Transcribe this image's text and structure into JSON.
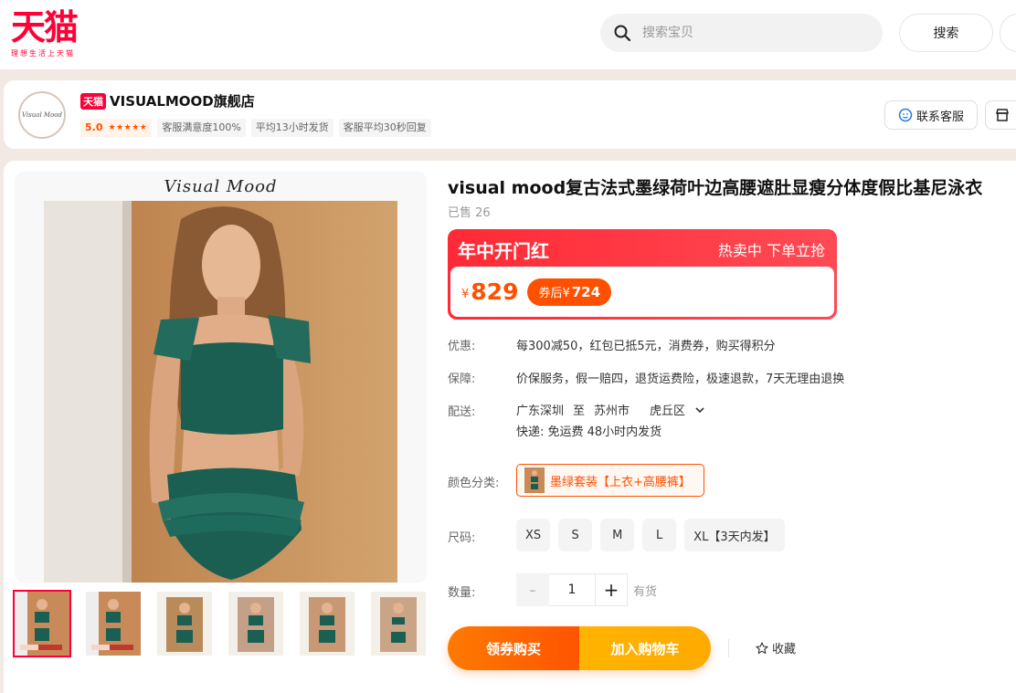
{
  "header": {
    "logo_text": "天猫",
    "logo_slogan": "理想生活上天猫",
    "search_placeholder": "搜索宝贝",
    "search_button": "搜索"
  },
  "shop": {
    "tmall_badge": "天猫",
    "name": "VISUALMOOD旗舰店",
    "avatar_text": "Visual Mood",
    "rating": "5.0",
    "stars": "★★★★★",
    "tags": [
      "客服满意度100%",
      "平均13小时发货",
      "客服平均30秒回复"
    ],
    "cs_button": "联系客服"
  },
  "gallery": {
    "brand_script": "Visual Mood"
  },
  "product": {
    "title": "visual mood复古法式墨绿荷叶边高腰遮肚显瘦分体度假比基尼泳衣",
    "sold": "已售 26",
    "promo_title": "年中开门红",
    "promo_sub": "热卖中 下单立抢",
    "currency": "¥",
    "price": "829",
    "coupon_prefix": "券后¥",
    "coupon_price": "724",
    "discount_label": "优惠:",
    "discount_value": "每300减50，红包已抵5元，消费券，购买得积分",
    "guarantee_label": "保障:",
    "guarantee_value": "价保服务，假一赔四，退货运费险，极速退款，7天无理由退换",
    "ship_label": "配送:",
    "ship_from": "广东深圳",
    "ship_to_word": "至",
    "ship_city": "苏州市",
    "ship_district": "虎丘区",
    "ship_detail": "快递: 免运费   48小时内发货",
    "color_label": "颜色分类:",
    "color_option": "墨绿套装【上衣+高腰裤】",
    "size_label": "尺码:",
    "sizes": [
      "XS",
      "S",
      "M",
      "L",
      "XL【3天内发】"
    ],
    "qty_label": "数量:",
    "qty_minus": "-",
    "qty_value": "1",
    "qty_plus": "+",
    "stock": "有货",
    "buy_now": "领券购买",
    "add_cart": "加入购物车",
    "favorite": "收藏"
  },
  "colors": {
    "brand_red": "#ff0036",
    "accent_orange": "#ff5000",
    "cart_yellow": "#ffaa00",
    "swimsuit_green": "#1b5f52"
  }
}
